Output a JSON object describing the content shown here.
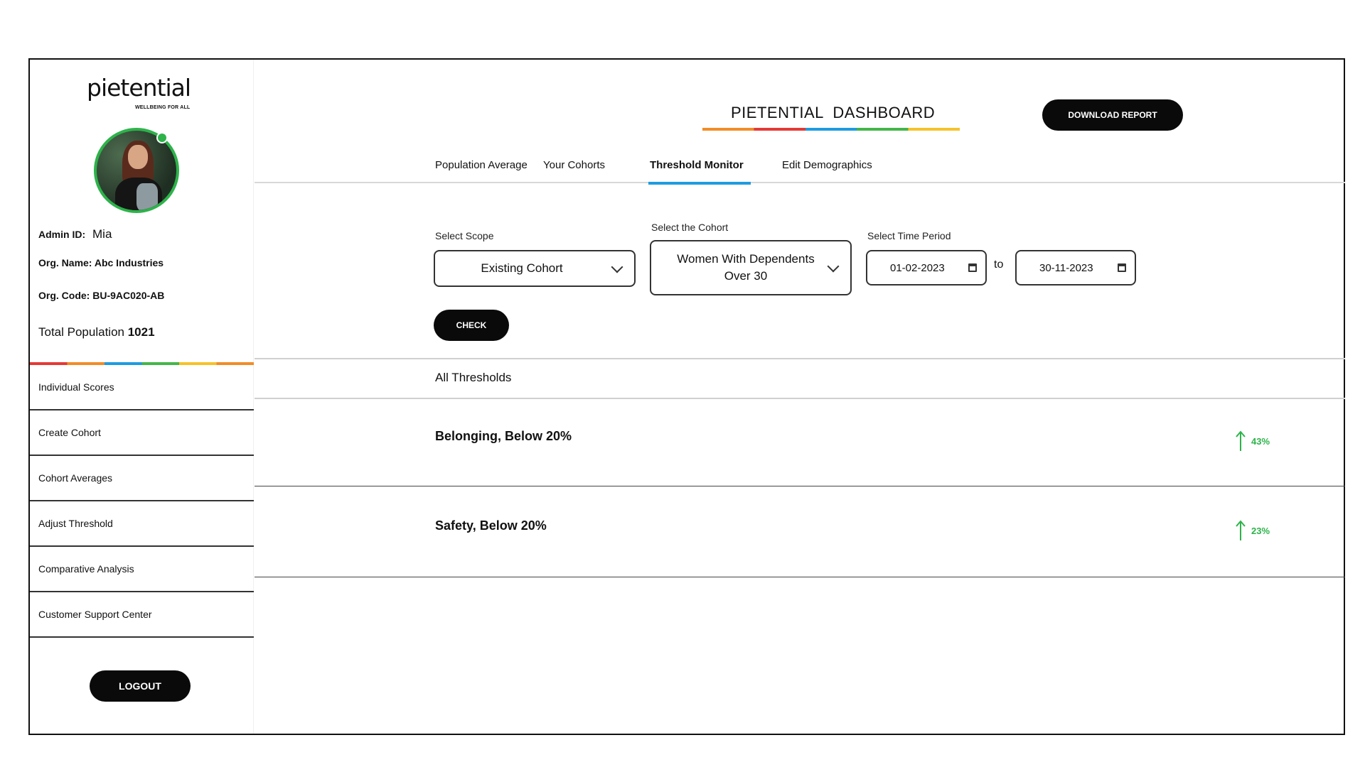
{
  "brand": {
    "name": "pietential",
    "tagline": "WELLBEING FOR ALL"
  },
  "profile": {
    "admin_label": "Admin ID:",
    "admin_value": "Mia",
    "org_name_label": "Org. Name:",
    "org_name_value": "Abc Industries",
    "org_code_label": "Org. Code:",
    "org_code_value": "BU-9AC020-AB",
    "population_label": "Total Population",
    "population_value": "1021"
  },
  "sidebar": {
    "items": [
      {
        "label": "Individual Scores"
      },
      {
        "label": "Create Cohort"
      },
      {
        "label": "Cohort Averages"
      },
      {
        "label": "Adjust Threshold"
      },
      {
        "label": "Comparative Analysis"
      },
      {
        "label": "Customer Support Center"
      }
    ],
    "logout_label": "LOGOUT"
  },
  "header": {
    "title": "PIETENTIAL  DASHBOARD",
    "download_label": "DOWNLOAD REPORT"
  },
  "tabs": [
    {
      "label": "Population Average",
      "active": false
    },
    {
      "label": "Your Cohorts",
      "active": false
    },
    {
      "label": "Threshold Monitor",
      "active": true
    },
    {
      "label": "Edit Demographics",
      "active": false
    }
  ],
  "filters": {
    "scope_label": "Select Scope",
    "scope_value": "Existing Cohort",
    "cohort_label": "Select the Cohort",
    "cohort_value": "Women With Dependents Over 30",
    "period_label": "Select Time Period",
    "date_from": "01-02-2023",
    "to_label": "to",
    "date_to": "30-11-2023",
    "check_label": "CHECK"
  },
  "thresholds": {
    "heading": "All Thresholds",
    "rows": [
      {
        "title": "Belonging, Below 20%",
        "change": "43%",
        "direction": "up"
      },
      {
        "title": "Safety, Below 20%",
        "change": "23%",
        "direction": "up"
      }
    ]
  },
  "colors": {
    "accent_green": "#2db34a",
    "accent_blue": "#1e9be0",
    "button_dark": "#0a0a0a"
  }
}
